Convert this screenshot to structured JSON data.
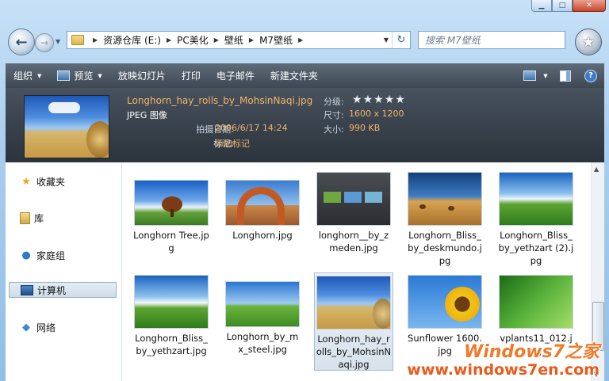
{
  "address": {
    "crumbs": [
      "资源仓库 (E:)",
      "PC美化",
      "壁纸",
      "M7壁纸"
    ]
  },
  "search": {
    "placeholder": "搜索 M7壁纸"
  },
  "toolbar": {
    "organize": "组织",
    "preview": "预览",
    "slideshow": "放映幻灯片",
    "print": "打印",
    "email": "电子邮件",
    "new_folder": "新建文件夹"
  },
  "details": {
    "filename": "Longhorn_hay_rolls_by_MohsinNaqi.jpg",
    "filetype": "JPEG 图像",
    "date_label": "拍摄日期:",
    "date_value": "2006/6/17 14:24",
    "tags_label": "标记:",
    "tags_value": "添加标记",
    "rating_label": "分级:",
    "rating": 0,
    "dimensions_label": "尺寸:",
    "dimensions_value": "1600 x 1200",
    "size_label": "大小:",
    "size_value": "990 KB"
  },
  "nav": {
    "favorites": "收藏夹",
    "libraries": "库",
    "homegroup": "家庭组",
    "computer": "计算机",
    "network": "网络"
  },
  "files": [
    {
      "name": "Longhorn Tree.jpg"
    },
    {
      "name": "Longhorn.jpg"
    },
    {
      "name": "longhorn__by_zmeden.jpg"
    },
    {
      "name": "Longhorn_Bliss_by_deskmundo.jpg"
    },
    {
      "name": "Longhorn_Bliss_by_yethzart (2).jpg"
    },
    {
      "name": "Longhorn_Bliss_by_yethzart.jpg"
    },
    {
      "name": "Longhorn_by_mx_steel.jpg"
    },
    {
      "name": "Longhorn_hay_rolls_by_MohsinNaqi.jpg"
    },
    {
      "name": "Sunflower 1600.jpg"
    },
    {
      "name": "vplants11_012.jpg"
    }
  ],
  "watermark": {
    "line1": "Windows7之家",
    "line2": "www.windows7en.com"
  }
}
